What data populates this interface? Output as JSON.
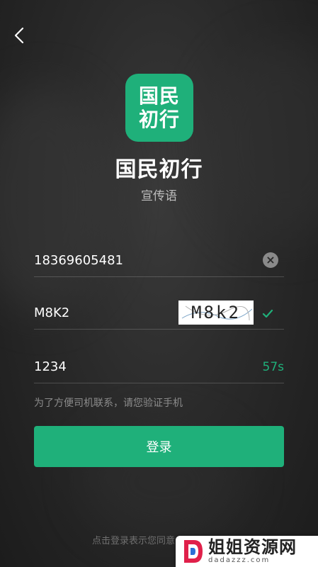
{
  "app": {
    "logo_line1": "国民",
    "logo_line2": "初行",
    "title": "国民初行",
    "slogan": "宣传语"
  },
  "form": {
    "phone_value": "18369605481",
    "captcha_input_value": "M8K2",
    "captcha_image_text": "M8k2",
    "sms_code_value": "1234",
    "countdown": "57s",
    "hint": "为了方便司机联系，请您验证手机"
  },
  "login_button_label": "登录",
  "agreement_text": "点击登录表示您同意",
  "watermark": {
    "main": "姐姐资源网",
    "sub": "dadazzz.com"
  },
  "colors": {
    "accent": "#1fb07a",
    "background": "#2a2a2a"
  },
  "icons": {
    "back": "chevron-left-icon",
    "clear": "clear-icon",
    "check": "check-icon"
  }
}
